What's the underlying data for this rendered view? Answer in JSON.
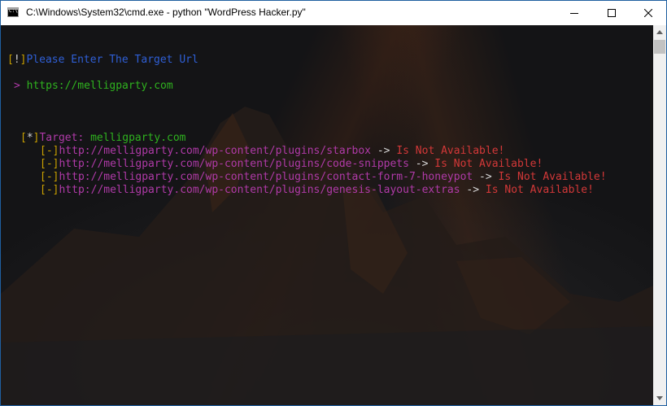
{
  "window": {
    "title": "C:\\Windows\\System32\\cmd.exe - python  \"WordPress Hacker.py\""
  },
  "console": {
    "prompt": {
      "bracket_open": "[",
      "bang": "!",
      "bracket_close": "]",
      "text": "Please Enter The Target Url"
    },
    "input": {
      "arrow": ">",
      "value": "https://melligparty.com"
    },
    "target": {
      "bracket_open": "[",
      "star": "*",
      "bracket_close": "]",
      "label": "Target:",
      "value": "melligparty.com"
    },
    "results": [
      {
        "marker": "[-]",
        "url": "http://melligparty.com/wp-content/plugins/starbox",
        "arrow": "->",
        "status": "Is Not Available!"
      },
      {
        "marker": "[-]",
        "url": "http://melligparty.com/wp-content/plugins/code-snippets",
        "arrow": "->",
        "status": "Is Not Available!"
      },
      {
        "marker": "[-]",
        "url": "http://melligparty.com/wp-content/plugins/contact-form-7-honeypot",
        "arrow": "->",
        "status": "Is Not Available!"
      },
      {
        "marker": "[-]",
        "url": "http://melligparty.com/wp-content/plugins/genesis-layout-extras",
        "arrow": "->",
        "status": "Is Not Available!"
      }
    ]
  },
  "controls": {
    "minimize_icon": "minimize-icon",
    "maximize_icon": "maximize-icon",
    "close_icon": "close-icon"
  },
  "colors": {
    "bracket": "#c9a000",
    "prompt_text": "#2f5fd6",
    "magenta": "#b03aa8",
    "green": "#2fb31f",
    "status_red": "#d33838",
    "titlebar_border": "#1f5fa0"
  }
}
